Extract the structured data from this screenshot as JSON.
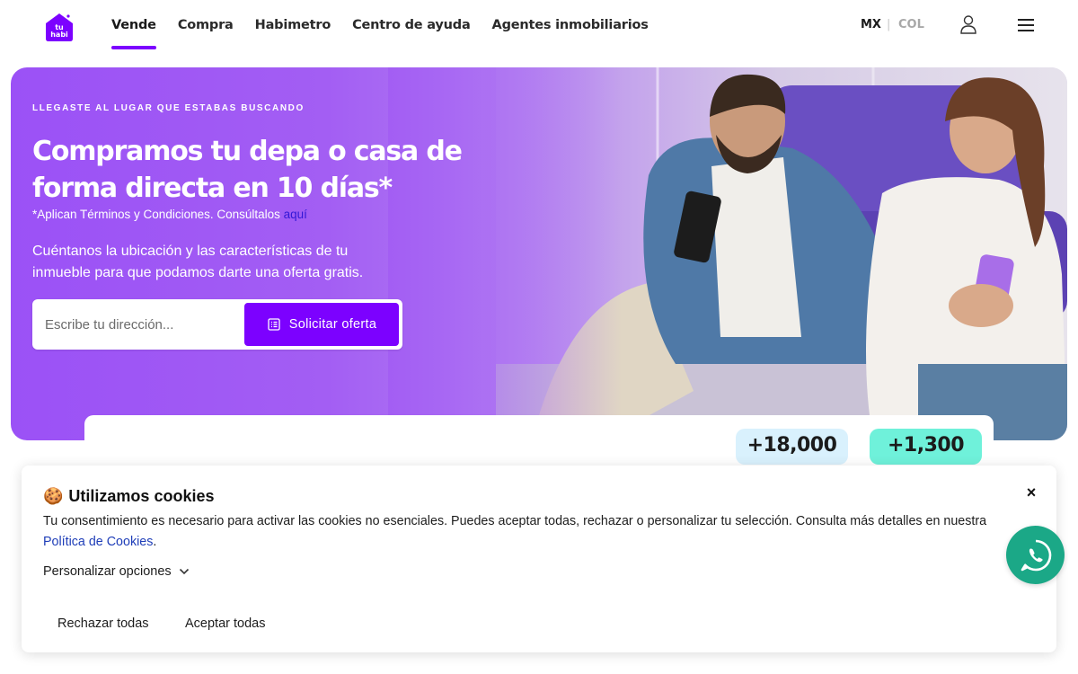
{
  "nav": {
    "logo": "tu habi",
    "links": [
      {
        "label": "Vende",
        "active": true
      },
      {
        "label": "Compra",
        "active": false
      },
      {
        "label": "Habimetro",
        "active": false
      },
      {
        "label": "Centro de ayuda",
        "active": false
      },
      {
        "label": "Agentes inmobiliarios",
        "active": false
      }
    ],
    "country_active": "MX",
    "country_separator": "|",
    "country_other": "COL",
    "user_icon": "user-icon",
    "menu_icon": "hamburger-menu-icon"
  },
  "hero": {
    "eyebrow": "LLEGASTE AL LUGAR QUE ESTABAS BUSCANDO",
    "headline": "Compramos tu depa o casa de forma directa en 10 días*",
    "terms_text": "*Aplican Términos y Condiciones. Consúltalos ",
    "terms_link": "aquí",
    "lead": "Cuéntanos la ubicación y las características de tu inmueble para que podamos darte una oferta gratis.",
    "search_placeholder": "Escribe tu dirección...",
    "search_value": "",
    "button_label": "Solicitar oferta",
    "button_icon": "form-list-icon"
  },
  "stats": [
    {
      "value": "+18,000"
    },
    {
      "value": "+1,300"
    }
  ],
  "cookie": {
    "emoji": "🍪",
    "title": "Utilizamos cookies",
    "text": "Tu consentimiento es necesario para activar las cookies no esenciales. Puedes aceptar todas, rechazar o personalizar tu selección. Consulta más detalles en nuestra ",
    "policy_link": "Política de Cookies",
    "text_end": ".",
    "personalize_label": "Personalizar opciones",
    "reject_label": "Rechazar todas",
    "accept_label": "Aceptar todas",
    "close_label": "×"
  },
  "colors": {
    "brand_purple": "#7c01ff",
    "hero_gradient_start": "#9b51f6",
    "link_blue": "#1f3eb8",
    "whatsapp_green": "#1ba887",
    "stat_blue": "#d9f1fd",
    "stat_mint": "#6ff1da"
  }
}
